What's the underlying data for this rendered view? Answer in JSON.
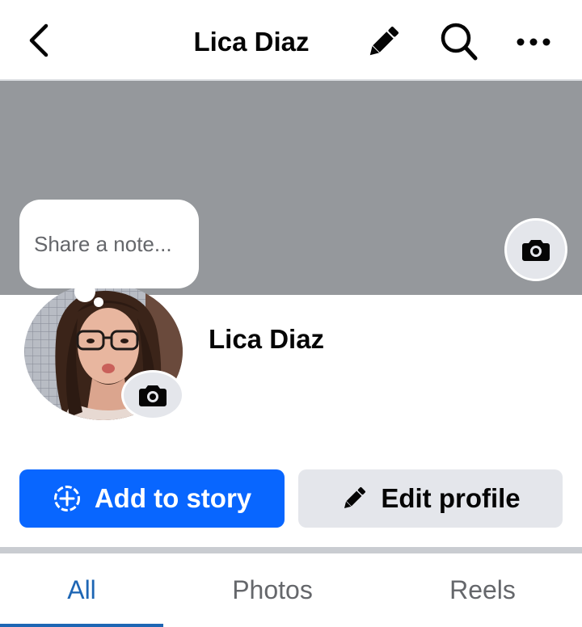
{
  "header": {
    "title": "Lica Diaz",
    "back_icon": "chevron-left-icon",
    "edit_icon": "pencil-icon",
    "search_icon": "search-icon",
    "more_icon": "more-horizontal-icon"
  },
  "cover": {
    "color": "#95989c",
    "camera_icon": "camera-icon"
  },
  "note": {
    "placeholder": "Share a note..."
  },
  "profile": {
    "name": "Lica Diaz",
    "avatar_camera_icon": "camera-icon"
  },
  "actions": {
    "add_story_label": "Add to story",
    "add_story_icon": "plus-circle-icon",
    "edit_profile_label": "Edit profile",
    "edit_profile_icon": "pencil-icon"
  },
  "tabs": [
    {
      "label": "All",
      "active": true
    },
    {
      "label": "Photos",
      "active": false
    },
    {
      "label": "Reels",
      "active": false
    }
  ],
  "colors": {
    "brand_blue": "#0866ff",
    "active_tab": "#1e66b4",
    "secondary_button": "#e4e6eb",
    "muted_text": "#65676b"
  }
}
